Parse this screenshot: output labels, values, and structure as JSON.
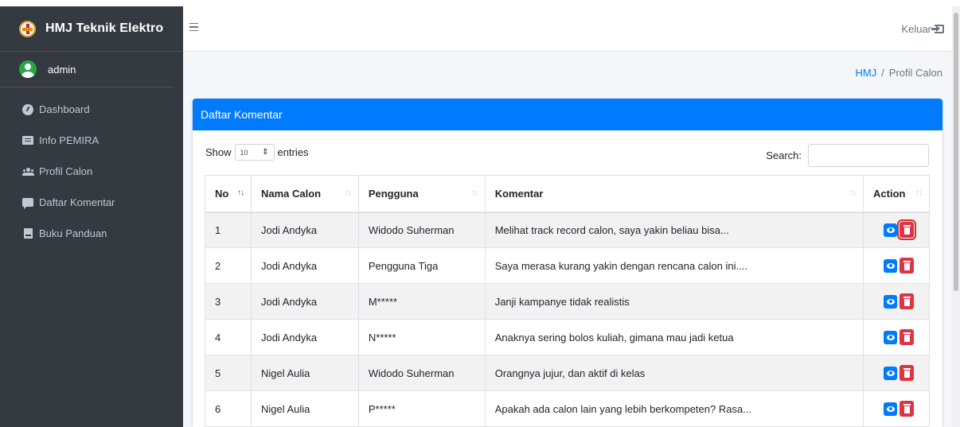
{
  "sidebar": {
    "brand": "HMJ Teknik Elektro",
    "user": "admin",
    "items": [
      {
        "label": "Dashboard",
        "icon": "dashboard-icon"
      },
      {
        "label": "Info PEMIRA",
        "icon": "newspaper-icon"
      },
      {
        "label": "Profil Calon",
        "icon": "users-icon"
      },
      {
        "label": "Daftar Komentar",
        "icon": "comment-icon"
      },
      {
        "label": "Buku Panduan",
        "icon": "book-icon"
      }
    ]
  },
  "navbar": {
    "logout": "Keluar"
  },
  "breadcrumb": {
    "home": "HMJ",
    "sep": "/",
    "current": "Profil Calon"
  },
  "card": {
    "title": "Daftar Komentar",
    "show": "Show",
    "entries_value": "10",
    "entries": "entries",
    "search_label": "Search:",
    "search_value": ""
  },
  "table": {
    "headers": [
      "No",
      "Nama Calon",
      "Pengguna",
      "Komentar",
      "Action"
    ],
    "rows": [
      {
        "no": "1",
        "nama": "Jodi Andyka",
        "pengguna": "Widodo Suherman",
        "komentar": "Melihat track record calon, saya yakin beliau bisa..."
      },
      {
        "no": "2",
        "nama": "Jodi Andyka",
        "pengguna": "Pengguna Tiga",
        "komentar": "Saya merasa kurang yakin dengan rencana calon ini...."
      },
      {
        "no": "3",
        "nama": "Jodi Andyka",
        "pengguna": "M*****",
        "komentar": "Janji kampanye tidak realistis"
      },
      {
        "no": "4",
        "nama": "Jodi Andyka",
        "pengguna": "N*****",
        "komentar": "Anaknya sering bolos kuliah, gimana mau jadi ketua"
      },
      {
        "no": "5",
        "nama": "Nigel Aulia",
        "pengguna": "Widodo Suherman",
        "komentar": "Orangnya jujur, dan aktif di kelas"
      },
      {
        "no": "6",
        "nama": "Nigel Aulia",
        "pengguna": "P*****",
        "komentar": "Apakah ada calon lain yang lebih berkompeten? Rasa..."
      }
    ]
  },
  "colors": {
    "primary": "#007bff",
    "danger": "#dc3545",
    "sidebar": "#343a40"
  }
}
